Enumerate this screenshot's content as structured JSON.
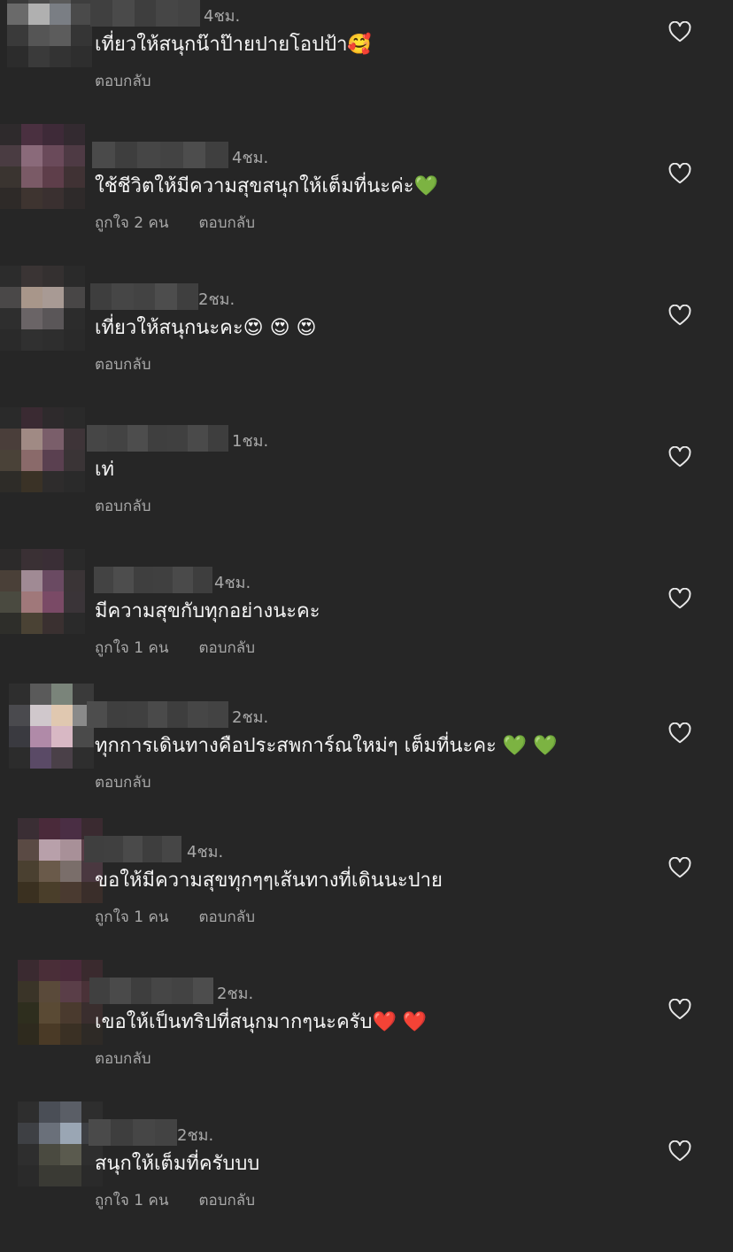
{
  "comments": [
    {
      "time": "4ชม.",
      "text": "เที่ยวให้สนุกน๊าป๊ายปายโอปป้า🥰",
      "likes": "",
      "reply": "ตอบกลับ"
    },
    {
      "time": "4ชม.",
      "text": "ใช้ชีวิตให้มีความสุขสนุกให้เต็มที่นะค่ะ💚",
      "likes": "ถูกใจ 2 คน",
      "reply": "ตอบกลับ"
    },
    {
      "time": "2ชม.",
      "text": "เที่ยวให้สนุกนะคะ😍 😍 😍",
      "likes": "",
      "reply": "ตอบกลับ"
    },
    {
      "time": "1ชม.",
      "text": "เท่",
      "likes": "",
      "reply": "ตอบกลับ"
    },
    {
      "time": "4ชม.",
      "text": "มีความสุขกับทุกอย่างนะคะ",
      "likes": "ถูกใจ 1 คน",
      "reply": "ตอบกลับ"
    },
    {
      "time": "2ชม.",
      "text": "ทุกการเดินทางคือประสพการ์ณใหม่ๆ เต็มที่นะคะ 💚 💚",
      "likes": "",
      "reply": "ตอบกลับ"
    },
    {
      "time": "4ชม.",
      "text": "ขอให้มีความสุขทุกๆๆเส้นทางที่เดินนะปาย",
      "likes": "ถูกใจ 1 คน",
      "reply": "ตอบกลับ"
    },
    {
      "time": "2ชม.",
      "text": "เขอให้เป็นทริปที่สนุกมากๆนะครับ❤️ ❤️",
      "likes": "",
      "reply": "ตอบกลับ"
    },
    {
      "time": "2ชม.",
      "text": "สนุกให้เต็มที่ครับบบ",
      "likes": "ถูกใจ 1 คน",
      "reply": "ตอบกลับ"
    }
  ],
  "icons": {
    "avatar": "pixelated-avatar-icon",
    "username": "blurred-username",
    "like": "heart-outline-icon"
  },
  "colors": {
    "background": "#262626",
    "text": "#f5f5f5",
    "muted": "#a8a8a8"
  }
}
